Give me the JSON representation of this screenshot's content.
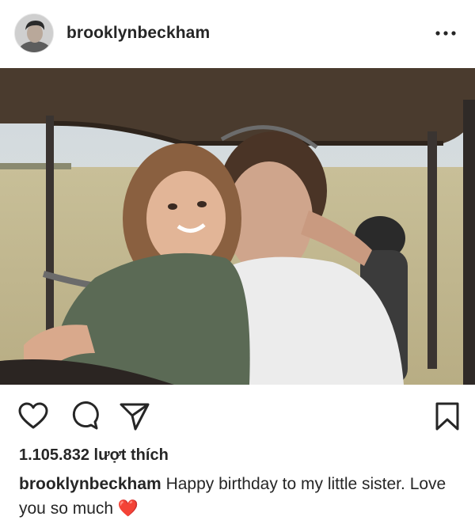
{
  "post": {
    "username": "brooklynbeckham",
    "likes_text": "1.105.832 lượt thích",
    "caption_user": "brooklynbeckham",
    "caption_text": " Happy birthday to my little sister. Love you so much ",
    "caption_emoji": "❤️"
  },
  "icons": {
    "more": "more-options-icon",
    "like": "heart-outline-icon",
    "comment": "comment-bubble-icon",
    "share": "paper-plane-icon",
    "save": "bookmark-icon"
  },
  "colors": {
    "emoji_heart": "#e8242c",
    "text": "#262626"
  }
}
